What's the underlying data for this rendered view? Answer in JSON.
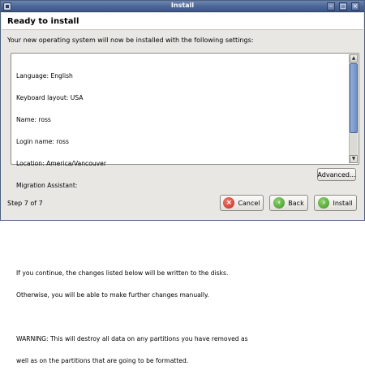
{
  "window": {
    "title": "Install"
  },
  "header": {
    "title": "Ready to install"
  },
  "subtitle": "Your new operating system will now be installed with the following settings:",
  "summary": {
    "settings": [
      "Language: English",
      "Keyboard layout: USA",
      "Name: ross",
      "Login name: ross",
      "Location: America/Vancouver",
      "Migration Assistant:"
    ],
    "notice_lines": [
      "If you continue, the changes listed below will be written to the disks.",
      "Otherwise, you will be able to make further changes manually."
    ],
    "warning_lines": [
      "WARNING: This will destroy all data on any partitions you have removed as",
      "well as on the partitions that are going to be formatted."
    ]
  },
  "buttons": {
    "advanced": "Advanced...",
    "cancel": "Cancel",
    "back": "Back",
    "install": "Install"
  },
  "step": "Step 7 of 7",
  "icons": {
    "cancel": "cancel-icon",
    "back": "back-icon",
    "install": "install-icon"
  },
  "colors": {
    "title_bar": "#4a6596",
    "scroll_thumb": "#6e8fc4",
    "cancel_red": "#c8281d",
    "go_green": "#3d9423"
  }
}
